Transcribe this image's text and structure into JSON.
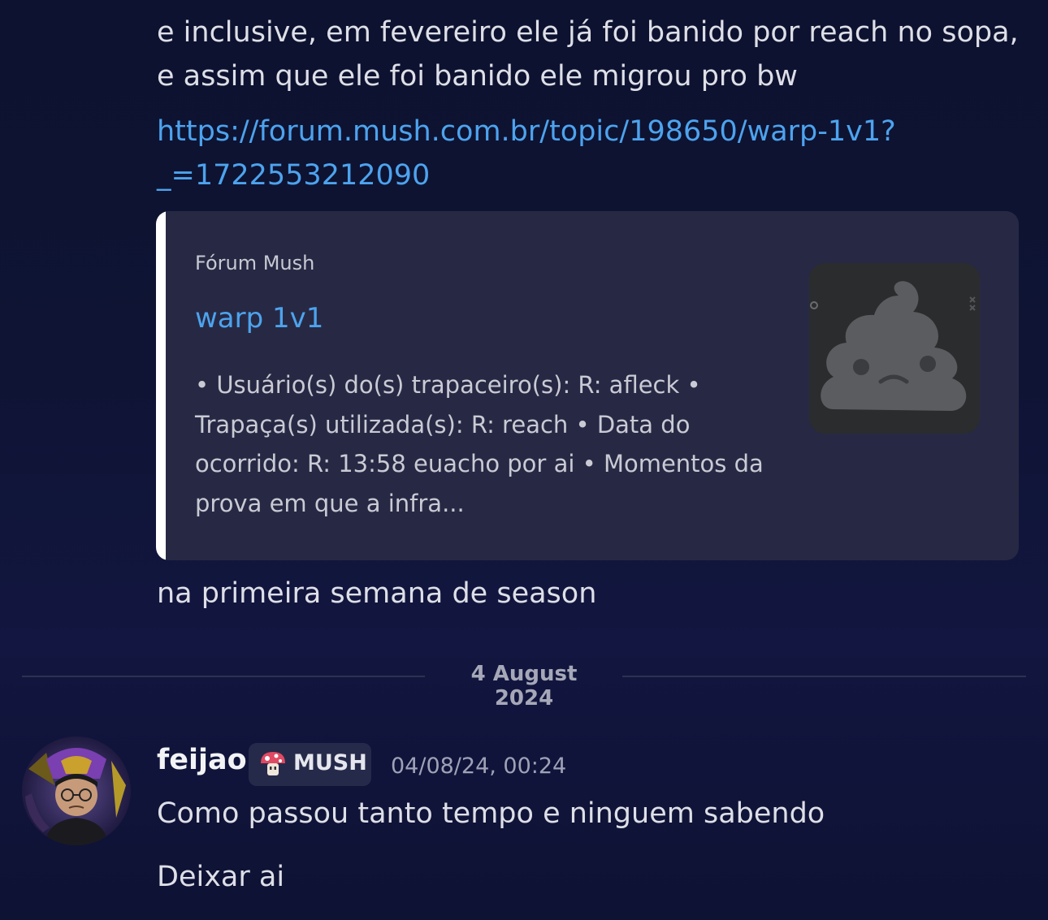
{
  "messages_prev": {
    "line1": "e inclusive, em fevereiro ele já foi banido por reach no sopa,",
    "line2": "e assim que ele foi banido ele migrou pro bw",
    "link_line1": "https://forum.mush.com.br/topic/198650/warp-1v1?",
    "link_line2": "_=1722553212090",
    "after_embed": "na primeira semana de season"
  },
  "embed": {
    "provider": "Fórum Mush",
    "title": "warp 1v1",
    "description_lines": [
      "• Usuário(s) do(s) trapaceiro(s): R: afleck •",
      "Trapaça(s) utilizada(s): R: reach • Data do",
      "ocorrido: R: 13:58 euacho por ai • Momentos da",
      "prova em que a infra..."
    ],
    "thumbnail_icon": "sad-poop-icon"
  },
  "date_divider": "4 August 2024",
  "new_message": {
    "author": "feijao",
    "server_tag": "MUSH",
    "server_tag_icon": "mushroom-icon",
    "timestamp": "04/08/24, 00:24",
    "lines": [
      "Como passou tanto tempo e ninguem sabendo",
      "Deixar ai"
    ]
  },
  "colors": {
    "link": "#4da3ee",
    "embed_bg": "#272944",
    "embed_accent": "#ffffff",
    "background": "#0f1434"
  }
}
